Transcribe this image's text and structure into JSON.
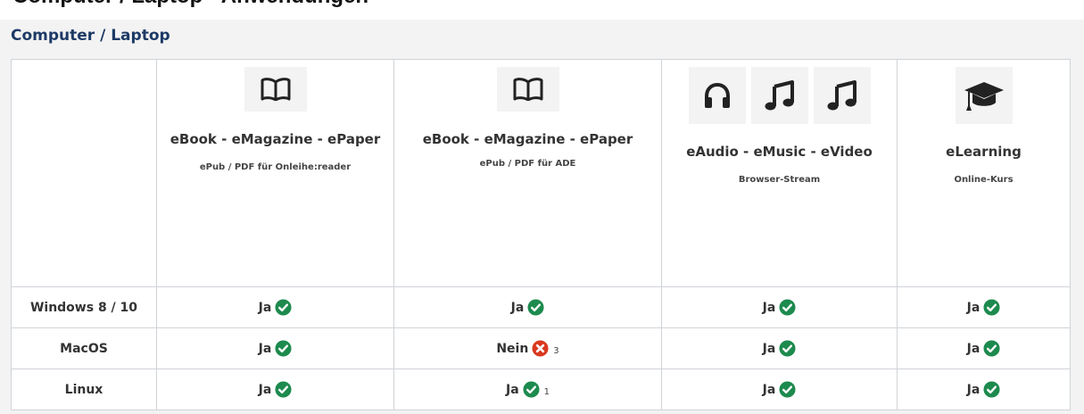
{
  "page": {
    "heading": "Computer / Laptop - Anwendungen"
  },
  "section": {
    "title": "Computer / Laptop"
  },
  "columns": [
    {
      "icons": [
        "book-open-icon"
      ],
      "title": "eBook - eMagazine - ePaper",
      "subtitle": "ePub / PDF für Onleihe:reader"
    },
    {
      "icons": [
        "book-open-icon"
      ],
      "title": "eBook - eMagazine - ePaper",
      "subtitle": "ePub / PDF für ADE"
    },
    {
      "icons": [
        "headphones-icon",
        "music-note-icon",
        "music-note-icon"
      ],
      "title": "eAudio - eMusic - eVideo",
      "subtitle": "Browser-Stream"
    },
    {
      "icons": [
        "graduation-cap-icon"
      ],
      "title": "eLearning",
      "subtitle": "Online-Kurs"
    }
  ],
  "rows": [
    {
      "os": "Windows 8 / 10",
      "cells": [
        {
          "label": "Ja",
          "status": "yes",
          "note": ""
        },
        {
          "label": "Ja",
          "status": "yes",
          "note": ""
        },
        {
          "label": "Ja",
          "status": "yes",
          "note": ""
        },
        {
          "label": "Ja",
          "status": "yes",
          "note": ""
        }
      ]
    },
    {
      "os": "MacOS",
      "cells": [
        {
          "label": "Ja",
          "status": "yes",
          "note": ""
        },
        {
          "label": "Nein",
          "status": "no",
          "note": "3"
        },
        {
          "label": "Ja",
          "status": "yes",
          "note": ""
        },
        {
          "label": "Ja",
          "status": "yes",
          "note": ""
        }
      ]
    },
    {
      "os": "Linux",
      "cells": [
        {
          "label": "Ja",
          "status": "yes",
          "note": ""
        },
        {
          "label": "Ja",
          "status": "yes",
          "note": "1"
        },
        {
          "label": "Ja",
          "status": "yes",
          "note": ""
        },
        {
          "label": "Ja",
          "status": "yes",
          "note": ""
        }
      ]
    }
  ],
  "colors": {
    "yes": "#1d8a4e",
    "no": "#d9391f",
    "title": "#1d3a66",
    "panel": "#f3f3f3",
    "tile": "#f3f3f3"
  }
}
